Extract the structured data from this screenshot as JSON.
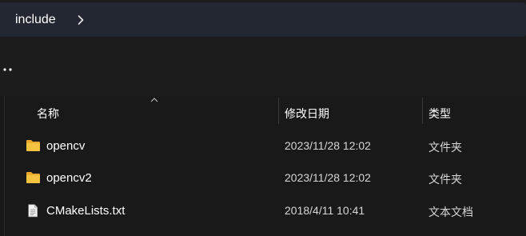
{
  "breadcrumb": {
    "path": [
      "include"
    ],
    "chevron_icon": "chevron-right-icon"
  },
  "toolbar": {
    "more_icon": "more-dots-icon"
  },
  "columns": {
    "name": "名称",
    "date": "修改日期",
    "type": "类型",
    "sort_icon": "sort-up-caret-icon"
  },
  "files": [
    {
      "name": "opencv",
      "date": "2023/11/28 12:02",
      "type": "文件夹",
      "icon": "folder-icon"
    },
    {
      "name": "opencv2",
      "date": "2023/11/28 12:02",
      "type": "文件夹",
      "icon": "folder-icon"
    },
    {
      "name": "CMakeLists.txt",
      "date": "2018/4/11 10:41",
      "type": "文本文档",
      "icon": "text-file-icon"
    }
  ],
  "colors": {
    "background": "#191919",
    "breadcrumb_bg": "#232732",
    "folder": "#f5c342",
    "text": "#ffffff",
    "secondary_text": "#d6d6d6"
  }
}
